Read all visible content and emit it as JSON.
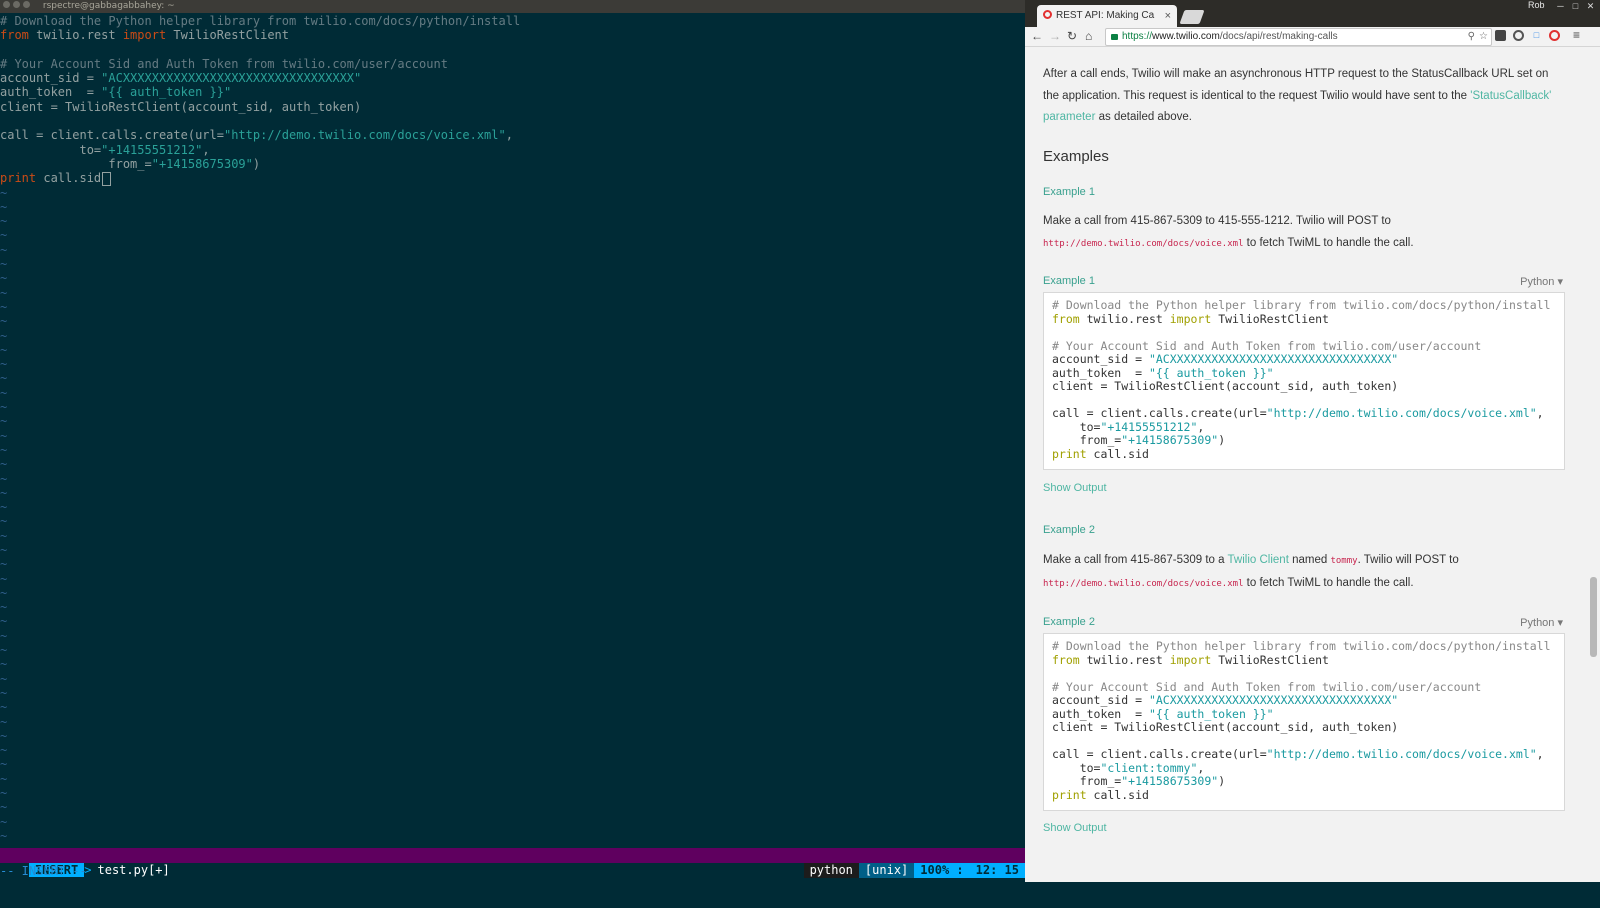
{
  "terminal": {
    "title": "rspectre@gabbagabbahey: ~",
    "code_lines": [
      [
        {
          "t": "# Download the Python helper library from twilio.com/docs/python/install",
          "c": "cm"
        }
      ],
      [
        {
          "t": "from",
          "c": "kw"
        },
        {
          "t": " twilio.rest ",
          "c": ""
        },
        {
          "t": "import",
          "c": "kw"
        },
        {
          "t": " TwilioRestClient",
          "c": ""
        }
      ],
      [],
      [
        {
          "t": "# Your Account Sid and Auth Token from twilio.com/user/account",
          "c": "cm"
        }
      ],
      [
        {
          "t": "account_sid = ",
          "c": ""
        },
        {
          "t": "\"ACXXXXXXXXXXXXXXXXXXXXXXXXXXXXXXXX\"",
          "c": "st"
        }
      ],
      [
        {
          "t": "auth_token  = ",
          "c": ""
        },
        {
          "t": "\"{{ auth_token }}\"",
          "c": "st"
        }
      ],
      [
        {
          "t": "client = TwilioRestClient(account_sid, auth_token)",
          "c": ""
        }
      ],
      [],
      [
        {
          "t": "call = client.calls.create(url=",
          "c": ""
        },
        {
          "t": "\"http://demo.twilio.com/docs/voice.xml\"",
          "c": "st"
        },
        {
          "t": ",",
          "c": ""
        }
      ],
      [
        {
          "t": "           to=",
          "c": ""
        },
        {
          "t": "\"+14155551212\"",
          "c": "st"
        },
        {
          "t": ",",
          "c": ""
        }
      ],
      [
        {
          "t": "               from_=",
          "c": ""
        },
        {
          "t": "\"+14158675309\"",
          "c": "st"
        },
        {
          "t": ")",
          "c": ""
        }
      ],
      [
        {
          "t": "print",
          "c": "kw"
        },
        {
          "t": " call.sid",
          "c": ""
        },
        {
          "t": "",
          "c": "cursor"
        }
      ]
    ],
    "tilde_count": 46,
    "tilde": "~",
    "status": {
      "mode": "INSERT",
      "arrow": ">",
      "filename": "test.py[+]",
      "filetype": "python",
      "fileformat": "[unix]",
      "percent": "100% :",
      "position": "12: 15"
    },
    "cmdline": "-- INSERT --"
  },
  "browser": {
    "tab_title": "REST API: Making Ca",
    "tab_close": "×",
    "profile_name": "Rob",
    "url_scheme": "https://",
    "url_host": "www.twilio.com",
    "url_path": "/docs/api/rest/making-calls",
    "intro": {
      "p1": "After a call ends, Twilio will make an asynchronous HTTP request to the StatusCallback URL set on the application. This request is identical to the request Twilio would have sent to the ",
      "link": "'StatusCallback' parameter",
      "p1_end": " as detailed above."
    },
    "examples_heading": "Examples",
    "example1": {
      "label": "Example 1",
      "desc_a": "Make a call from 415-867-5309 to 415-555-1212. Twilio will POST to",
      "url_code": "http://demo.twilio.com/docs/voice.xml",
      "desc_b": " to fetch TwiML to handle the call.",
      "code_label": "Example 1",
      "lang": "Python ▾",
      "code": [
        [
          {
            "t": "# Download the Python helper library from twilio.com/docs/python/install",
            "c": "cm2"
          }
        ],
        [
          {
            "t": "from",
            "c": "kw2"
          },
          {
            "t": " twilio.rest ",
            "c": ""
          },
          {
            "t": "import",
            "c": "kw2"
          },
          {
            "t": " TwilioRestClient",
            "c": ""
          }
        ],
        [],
        [
          {
            "t": "# Your Account Sid and Auth Token from twilio.com/user/account",
            "c": "cm2"
          }
        ],
        [
          {
            "t": "account_sid = ",
            "c": ""
          },
          {
            "t": "\"ACXXXXXXXXXXXXXXXXXXXXXXXXXXXXXXXX\"",
            "c": "st2"
          }
        ],
        [
          {
            "t": "auth_token  = ",
            "c": ""
          },
          {
            "t": "\"{{ auth_token }}\"",
            "c": "st2"
          }
        ],
        [
          {
            "t": "client = TwilioRestClient(account_sid, auth_token)",
            "c": ""
          }
        ],
        [],
        [
          {
            "t": "call = client.calls.create(url=",
            "c": ""
          },
          {
            "t": "\"http://demo.twilio.com/docs/voice.xml\"",
            "c": "st2"
          },
          {
            "t": ",",
            "c": ""
          }
        ],
        [
          {
            "t": "    to=",
            "c": ""
          },
          {
            "t": "\"+14155551212\"",
            "c": "st2"
          },
          {
            "t": ",",
            "c": ""
          }
        ],
        [
          {
            "t": "    from_=",
            "c": ""
          },
          {
            "t": "\"+14158675309\"",
            "c": "st2"
          },
          {
            "t": ")",
            "c": ""
          }
        ],
        [
          {
            "t": "print",
            "c": "kw2"
          },
          {
            "t": " call.sid",
            "c": ""
          }
        ]
      ],
      "show_output": "Show Output"
    },
    "example2": {
      "label": "Example 2",
      "desc_a": "Make a call from 415-867-5309 to a ",
      "desc_link": "Twilio Client",
      "desc_mid": " named ",
      "desc_code": "tommy",
      "desc_mid2": ". Twilio will POST to",
      "url_code": "http://demo.twilio.com/docs/voice.xml",
      "desc_b": " to fetch TwiML to handle the call.",
      "code_label": "Example 2",
      "lang": "Python ▾",
      "code": [
        [
          {
            "t": "# Download the Python helper library from twilio.com/docs/python/install",
            "c": "cm2"
          }
        ],
        [
          {
            "t": "from",
            "c": "kw2"
          },
          {
            "t": " twilio.rest ",
            "c": ""
          },
          {
            "t": "import",
            "c": "kw2"
          },
          {
            "t": " TwilioRestClient",
            "c": ""
          }
        ],
        [],
        [
          {
            "t": "# Your Account Sid and Auth Token from twilio.com/user/account",
            "c": "cm2"
          }
        ],
        [
          {
            "t": "account_sid = ",
            "c": ""
          },
          {
            "t": "\"ACXXXXXXXXXXXXXXXXXXXXXXXXXXXXXXXX\"",
            "c": "st2"
          }
        ],
        [
          {
            "t": "auth_token  = ",
            "c": ""
          },
          {
            "t": "\"{{ auth_token }}\"",
            "c": "st2"
          }
        ],
        [
          {
            "t": "client = TwilioRestClient(account_sid, auth_token)",
            "c": ""
          }
        ],
        [],
        [
          {
            "t": "call = client.calls.create(url=",
            "c": ""
          },
          {
            "t": "\"http://demo.twilio.com/docs/voice.xml\"",
            "c": "st2"
          },
          {
            "t": ",",
            "c": ""
          }
        ],
        [
          {
            "t": "    to=",
            "c": ""
          },
          {
            "t": "\"client:tommy\"",
            "c": "st2"
          },
          {
            "t": ",",
            "c": ""
          }
        ],
        [
          {
            "t": "    from_=",
            "c": ""
          },
          {
            "t": "\"+14158675309\"",
            "c": "st2"
          },
          {
            "t": ")",
            "c": ""
          }
        ],
        [
          {
            "t": "print",
            "c": "kw2"
          },
          {
            "t": " call.sid",
            "c": ""
          }
        ]
      ],
      "show_output": "Show Output"
    }
  }
}
